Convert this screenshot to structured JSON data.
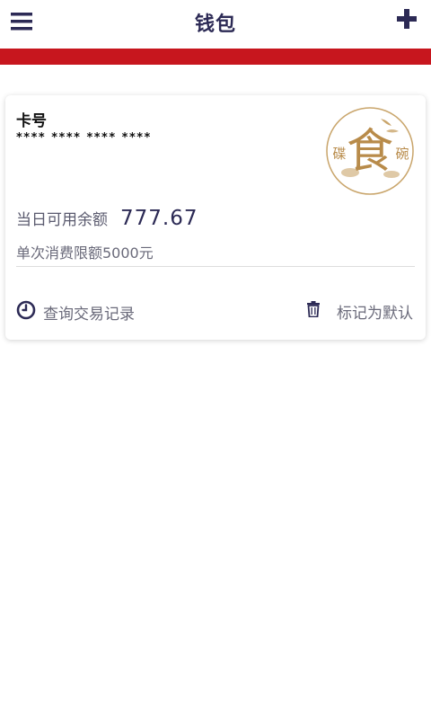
{
  "header": {
    "title": "钱包",
    "menu_icon": "hamburger-menu-icon",
    "add_icon": "plus-icon"
  },
  "colors": {
    "accent": "#2c2a55",
    "banner": "#c7161e",
    "logo_gold": "#c9a56b"
  },
  "card": {
    "label": "卡号",
    "number": "**** **** **** ****",
    "logo": {
      "glyph": "食",
      "left_text": "碟",
      "right_text": "碗"
    },
    "balance_label": "当日可用余额",
    "balance_value": "777.67",
    "limit_text": "单次消费限额5000元",
    "actions": {
      "history_label": "查询交易记录",
      "history_icon": "clock-icon",
      "default_label": "标记为默认",
      "default_icon": "trash-icon"
    }
  }
}
